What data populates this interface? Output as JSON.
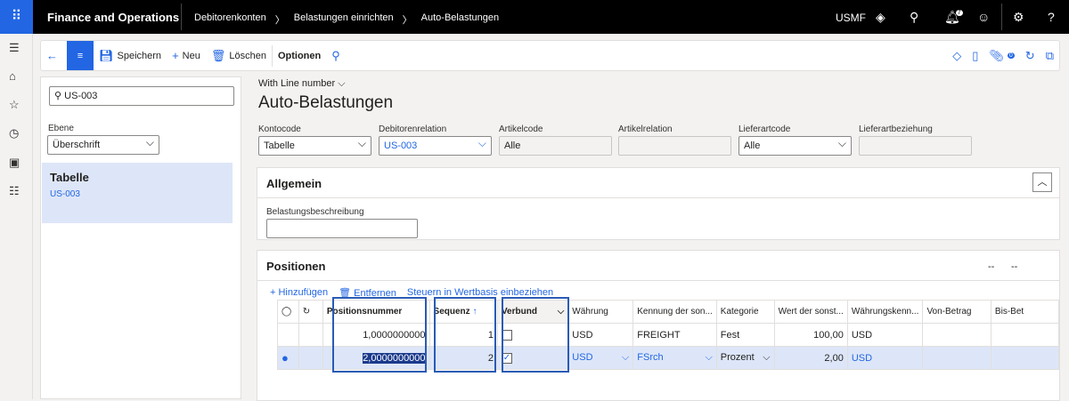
{
  "topbar": {
    "app_title": "Finance and Operations",
    "breadcrumbs": [
      "Debitorenkonten",
      "Belastungen einrichten",
      "Auto-Belastungen"
    ],
    "company": "USMF",
    "notification_count": "7"
  },
  "toolbar": {
    "save": "Speichern",
    "new": "Neu",
    "delete": "Löschen",
    "options": "Optionen",
    "badge": "0"
  },
  "left": {
    "search_value": "US-003",
    "level_label": "Ebene",
    "level_value": "Überschrift",
    "item_title": "Tabelle",
    "item_sub": "US-003"
  },
  "main": {
    "view": "With Line number",
    "title": "Auto-Belastungen",
    "fields": [
      {
        "label": "Kontocode",
        "value": "Tabelle"
      },
      {
        "label": "Debitorenrelation",
        "value": "US-003"
      },
      {
        "label": "Artikelcode",
        "value": "Alle"
      },
      {
        "label": "Artikelrelation",
        "value": ""
      },
      {
        "label": "Lieferartcode",
        "value": "Alle"
      },
      {
        "label": "Lieferartbeziehung",
        "value": ""
      }
    ],
    "general": {
      "title": "Allgemein",
      "desc_label": "Belastungsbeschreibung",
      "desc_value": ""
    },
    "positions": {
      "title": "Positionen",
      "right1": "--",
      "right2": "--",
      "add": "Hinzufügen",
      "remove": "Entfernen",
      "tax": "Steuern in Wertbasis einbeziehen",
      "columns": [
        "Positionsnummer",
        "Sequenz",
        "Verbund",
        "Währung",
        "Kennung der son...",
        "Kategorie",
        "Wert der sonst...",
        "Währungskenn...",
        "Von-Betrag",
        "Bis-Bet"
      ],
      "rows": [
        [
          "1,0000000000",
          "1",
          "",
          "USD",
          "FREIGHT",
          "Fest",
          "100,00",
          "USD",
          "",
          ""
        ],
        [
          "2,0000000000",
          "2",
          "✓",
          "USD",
          "FSrch",
          "Prozent",
          "2,00",
          "USD",
          "",
          ""
        ]
      ]
    }
  },
  "colors": {
    "accent": "#2266e3",
    "topbar": "#000000",
    "selected": "#dde6f8"
  }
}
